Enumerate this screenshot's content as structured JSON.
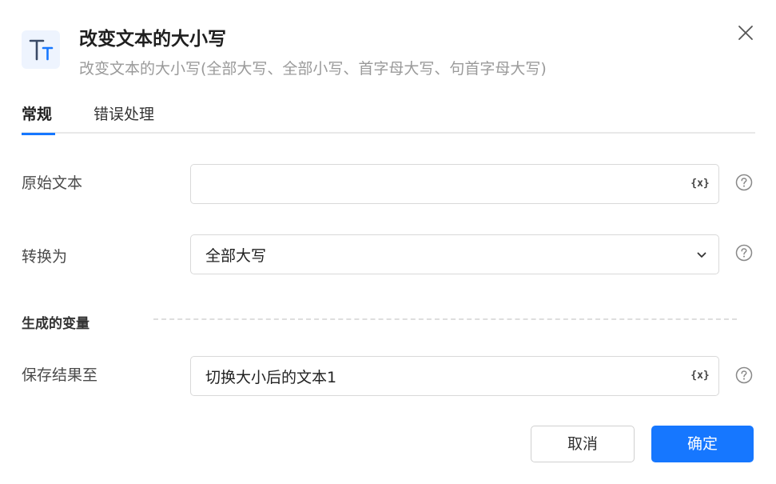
{
  "dialog": {
    "title": "改变文本的大小写",
    "subtitle": "改变文本的大小写(全部大写、全部小写、首字母大写、句首字母大写)",
    "icon": "text-case-icon"
  },
  "tabs": [
    {
      "label": "常规",
      "active": true
    },
    {
      "label": "错误处理",
      "active": false
    }
  ],
  "fields": {
    "source_text": {
      "label": "原始文本",
      "value": "",
      "variable_button": "{x}"
    },
    "convert_to": {
      "label": "转换为",
      "selected": "全部大写"
    },
    "save_to": {
      "label": "保存结果至",
      "value": "切换大小后的文本1",
      "variable_button": "{x}"
    }
  },
  "section": {
    "generated_variables": "生成的变量"
  },
  "buttons": {
    "cancel": "取消",
    "confirm": "确定"
  },
  "colors": {
    "accent": "#1677ff",
    "icon_bg": "#eef4fe"
  }
}
